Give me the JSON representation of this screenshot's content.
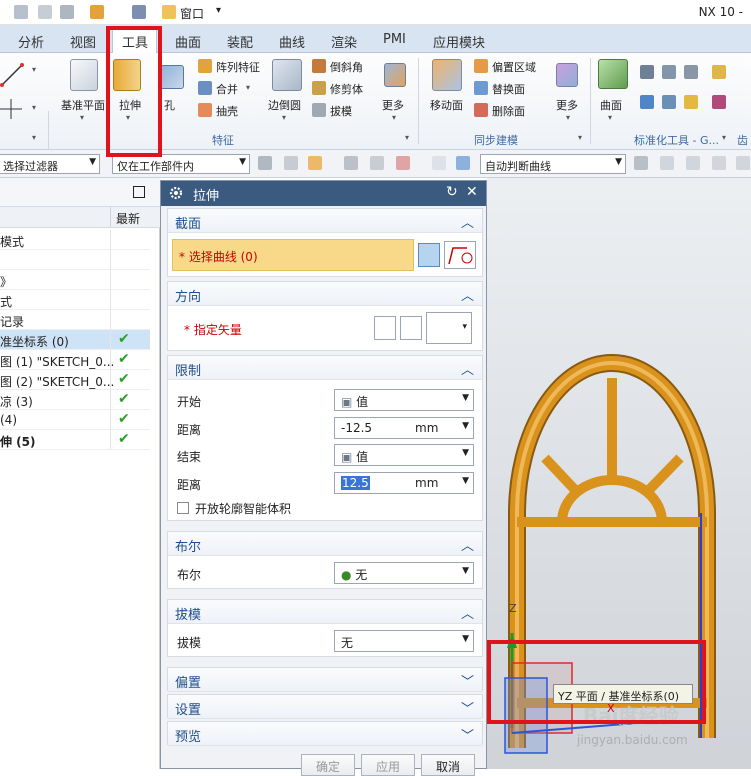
{
  "app": {
    "title": "NX 10 -",
    "window_menu": "窗口",
    "window_menu_caret": "▾"
  },
  "tabs": [
    "分析",
    "视图",
    "工具",
    "曲面",
    "装配",
    "曲线",
    "渲染",
    "PMI",
    "应用模块"
  ],
  "ribbon": {
    "datum_plane": "基准平面",
    "extrude": "拉伸",
    "hole": "孔",
    "pattern_feature": "阵列特征",
    "unite": "合并",
    "shell": "抽壳",
    "edge_blend": "边倒圆",
    "chamfer": "倒斜角",
    "trim_body": "修剪体",
    "draft": "拔模",
    "more1": "更多",
    "move_face": "移动面",
    "offset_region": "偏置区域",
    "replace_face": "替换面",
    "delete_face": "删除面",
    "more2": "更多",
    "surface": "曲面",
    "group_feature": "特征",
    "group_sync": "同步建模",
    "group_standard": "标准化工具 - G...",
    "group_cut": "齿轮"
  },
  "filterbar": {
    "type_filter": "选择过滤器",
    "scope": "仅在工作部件内",
    "curve_rule": "自动判断曲线"
  },
  "navigator": {
    "col_latest": "最新",
    "rows": [
      {
        "label": "模式",
        "check": ""
      },
      {
        "label": "",
        "check": ""
      },
      {
        "label": "》",
        "check": ""
      },
      {
        "label": "式",
        "check": ""
      },
      {
        "label": "记录",
        "check": ""
      },
      {
        "label": "准坐标系 (0)",
        "check": "✔"
      },
      {
        "label": "图 (1) \"SKETCH_0...",
        "check": "✔"
      },
      {
        "label": "图 (2) \"SKETCH_0...",
        "check": "✔"
      },
      {
        "label": "凉 (3)",
        "check": "✔"
      },
      {
        "label": "(4)",
        "check": "✔"
      },
      {
        "label": "伸 (5)",
        "check": "✔"
      }
    ]
  },
  "dialog": {
    "title": "拉伸",
    "reset_icon": "↻",
    "close_icon": "✕",
    "section_curve": {
      "title": "截面",
      "select_label": "* 选择曲线 (0)"
    },
    "section_direction": {
      "title": "方向",
      "vector_label": "* 指定矢量"
    },
    "section_limits": {
      "title": "限制",
      "start_label": "开始",
      "start_value": "值",
      "dist1_label": "距离",
      "dist1_value": "-12.5",
      "dist1_unit": "mm",
      "end_label": "结束",
      "end_value": "值",
      "dist2_label": "距离",
      "dist2_value": "12.5",
      "dist2_unit": "mm",
      "open_profile": "开放轮廓智能体积"
    },
    "section_boolean": {
      "title": "布尔",
      "label": "布尔",
      "value": "无"
    },
    "section_draft": {
      "title": "拔模",
      "label": "拔模",
      "value": "无"
    },
    "section_offset": {
      "title": "偏置"
    },
    "section_settings": {
      "title": "设置"
    },
    "section_preview": {
      "title": "预览"
    },
    "ok": "确定",
    "apply": "应用",
    "cancel": "取消"
  },
  "viewport": {
    "axis_z": "Z",
    "axis_x": "X",
    "tooltip": "YZ 平面 / 基准坐标系(0)",
    "watermark": "Bai度经验",
    "watermark_url": "jingyan.baidu.com"
  },
  "colors": {
    "accent_red": "#e0121c",
    "frame_orange": "#d9931c",
    "dialog_title": "#3a5a80",
    "check_green": "#2aa02a"
  }
}
